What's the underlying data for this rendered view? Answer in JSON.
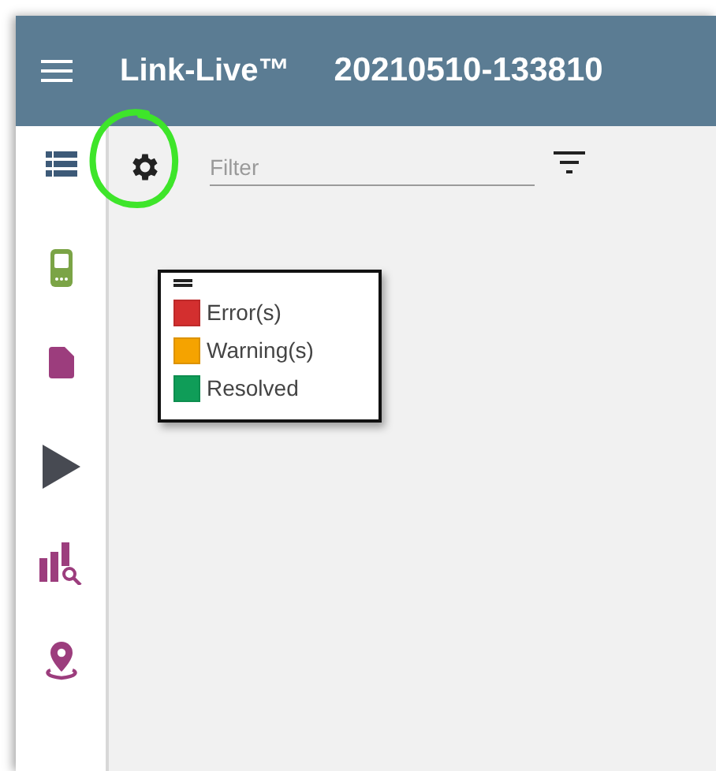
{
  "header": {
    "app_name": "Link-Live™",
    "record_id": "20210510-133810"
  },
  "sidebar": {
    "items": [
      {
        "kind": "list"
      },
      {
        "kind": "device"
      },
      {
        "kind": "document"
      },
      {
        "kind": "play"
      },
      {
        "kind": "chart-search"
      },
      {
        "kind": "location"
      }
    ]
  },
  "toolbar": {
    "filter": {
      "placeholder": "Filter"
    }
  },
  "legend": {
    "items": [
      {
        "label": "Error(s)",
        "color": "#d32f2f"
      },
      {
        "label": "Warning(s)",
        "color": "#f5a300"
      },
      {
        "label": "Resolved",
        "color": "#0f9d58"
      }
    ]
  }
}
